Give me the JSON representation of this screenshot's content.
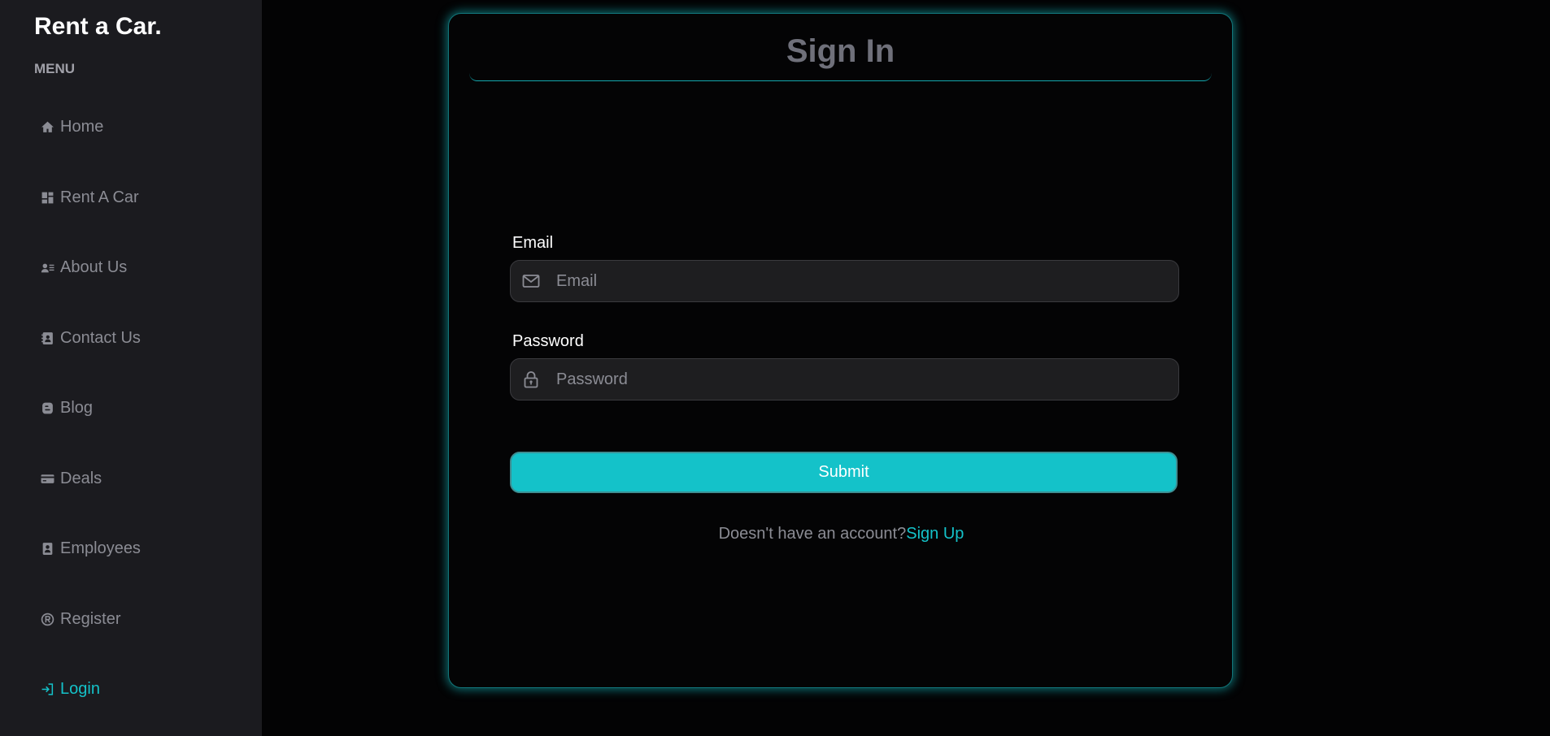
{
  "sidebar": {
    "brand": "Rent a Car.",
    "menu_label": "MENU",
    "items": [
      {
        "label": "Home",
        "icon": "home-icon"
      },
      {
        "label": "Rent A Car",
        "icon": "dashboard-icon"
      },
      {
        "label": "About Us",
        "icon": "contact-card-icon"
      },
      {
        "label": "Contact Us",
        "icon": "address-book-icon"
      },
      {
        "label": "Blog",
        "icon": "blog-icon"
      },
      {
        "label": "Deals",
        "icon": "credit-card-icon"
      },
      {
        "label": "Employees",
        "icon": "badge-icon"
      },
      {
        "label": "Register",
        "icon": "registered-icon"
      },
      {
        "label": "Login",
        "icon": "login-icon",
        "active": true
      }
    ]
  },
  "form": {
    "title": "Sign In",
    "email_label": "Email",
    "email_placeholder": "Email",
    "email_value": "",
    "email_icon": "envelope-icon",
    "password_label": "Password",
    "password_placeholder": "Password",
    "password_value": "",
    "password_icon": "lock-icon",
    "submit_label": "Submit",
    "signup_prompt": "Doesn't have an account?",
    "signup_link": "Sign Up"
  },
  "colors": {
    "accent": "#14c2c9",
    "sidebar_bg": "#1b1b1f",
    "page_bg": "#030304",
    "muted_text": "#8b8c94"
  }
}
